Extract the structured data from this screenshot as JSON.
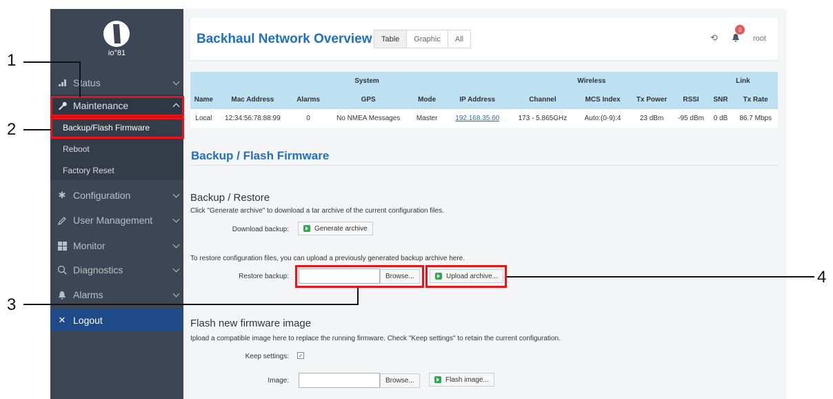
{
  "logo": {
    "text": "io°81"
  },
  "sidebar": {
    "items": [
      {
        "label": "Status",
        "icon": "chart-icon"
      },
      {
        "label": "Maintenance",
        "icon": "wrench-icon"
      },
      {
        "label": "Configuration",
        "icon": "gear-icon"
      },
      {
        "label": "User Management",
        "icon": "pencil-icon"
      },
      {
        "label": "Monitor",
        "icon": "grid-icon"
      },
      {
        "label": "Diagnostics",
        "icon": "search-icon"
      },
      {
        "label": "Alarms",
        "icon": "bell-icon"
      }
    ],
    "subitems": [
      "Backup/Flash Firmware",
      "Reboot",
      "Factory Reset"
    ],
    "logout": "Logout"
  },
  "header": {
    "title": "Backhaul Network Overview",
    "tabs": [
      "Table",
      "Graphic",
      "All"
    ],
    "notifications": "0",
    "user": "root"
  },
  "overview": {
    "groups": {
      "system": "System",
      "wireless": "Wireless",
      "link": "Link"
    },
    "columns": [
      "Name",
      "Mac Address",
      "Alarms",
      "GPS",
      "Mode",
      "IP Address",
      "Channel",
      "MCS Index",
      "Tx Power",
      "RSSI",
      "SNR",
      "Tx Rate"
    ],
    "row": [
      "Local",
      "12:34:56:78:88:99",
      "0",
      "No NMEA Messages",
      "Master",
      "192.168.35.60",
      "173 - 5.865GHz",
      "Auto:(0-9):4",
      "23 dBm",
      "-95 dBm",
      "0 dB",
      "86.7 Mbps"
    ]
  },
  "main": {
    "title": "Backup / Flash Firmware",
    "backup": {
      "heading": "Backup / Restore",
      "desc": "Click \"Generate archive\" to download a tar archive of the current configuration files.",
      "download_label": "Download backup:",
      "generate_btn": "Generate archive",
      "restore_desc": "To restore configuration files, you can upload a previously generated backup archive here.",
      "restore_label": "Restore backup:",
      "browse_btn": "Browse...",
      "upload_btn": "Upload archive..."
    },
    "flash": {
      "heading": "Flash new firmware image",
      "desc": "Ipload a compatible image here to replace the running firmware. Check \"Keep settings\" to retain the current configuration.",
      "keep_label": "Keep settings:",
      "image_label": "Image:",
      "browse_btn": "Browse...",
      "flash_btn": "Flash image..."
    }
  },
  "callouts": [
    "1",
    "2",
    "3",
    "4"
  ]
}
